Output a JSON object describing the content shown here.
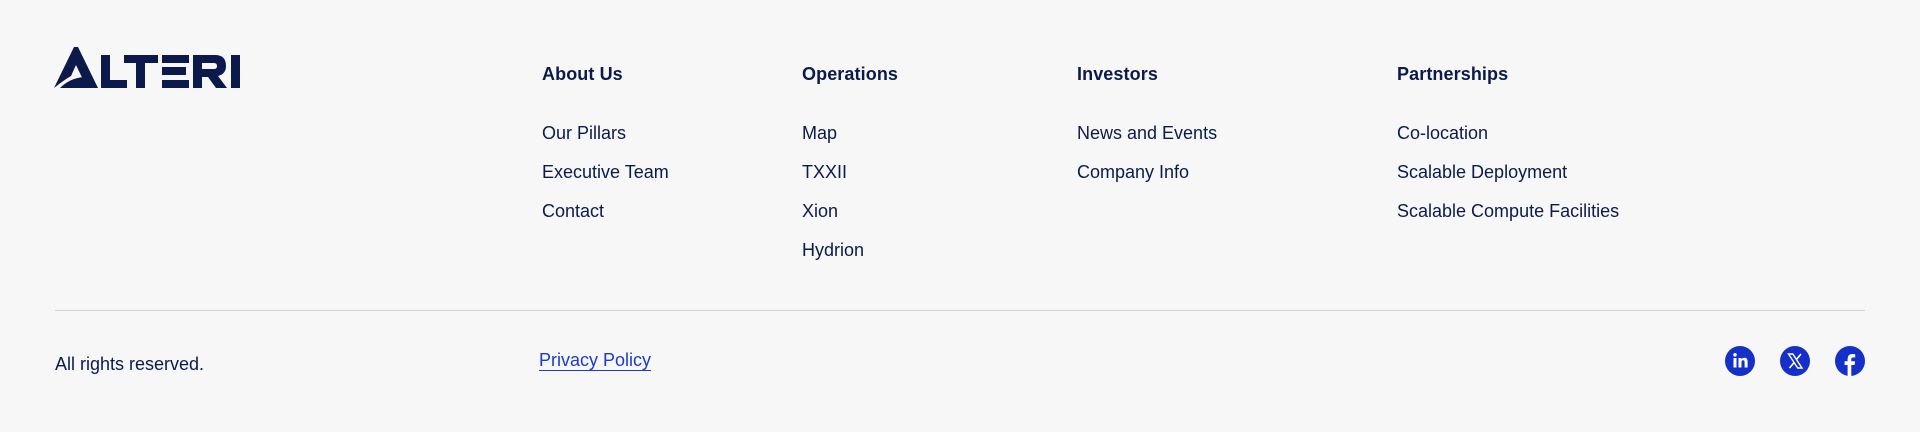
{
  "brand": {
    "name": "ALTERI",
    "color": "#0b1a4a",
    "accent": "#1530c9"
  },
  "columns": [
    {
      "heading": "About Us",
      "links": [
        "Our Pillars",
        "Executive Team",
        "Contact"
      ]
    },
    {
      "heading": "Operations",
      "links": [
        "Map",
        "TXXII",
        "Xion",
        "Hydrion"
      ]
    },
    {
      "heading": "Investors",
      "links": [
        "News and Events",
        "Company Info"
      ]
    },
    {
      "heading": "Partnerships",
      "links": [
        "Co-location",
        "Scalable Deployment",
        "Scalable Compute Facilities"
      ]
    }
  ],
  "bottom": {
    "rights": "All rights reserved.",
    "privacy": "Privacy Policy"
  },
  "social": [
    {
      "icon": "linkedin-icon"
    },
    {
      "icon": "x-icon"
    },
    {
      "icon": "facebook-icon"
    }
  ]
}
